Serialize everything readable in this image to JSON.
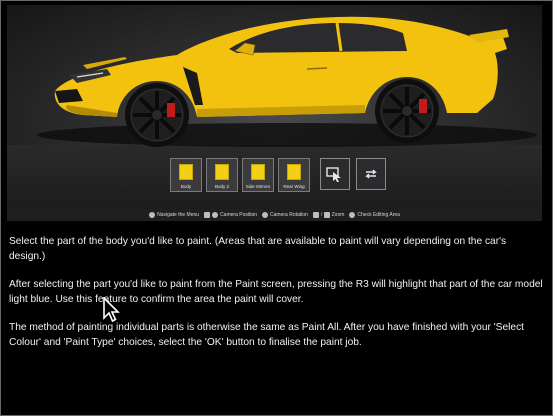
{
  "paint_parts": [
    {
      "label": "Body"
    },
    {
      "label": "Body 2"
    },
    {
      "label": "Side Mirrors"
    },
    {
      "label": "Rear Wing"
    }
  ],
  "colors": {
    "car_body": "#f2c20f",
    "swatch": "#f3cf16",
    "background": "#000000",
    "text": "#f2f2f2"
  },
  "controls": {
    "navigate": "Navigate the Menu",
    "camera_position": "Camera Position",
    "camera_rotation": "Camera Rotation",
    "zoom_sep": "/",
    "zoom": "Zoom",
    "check_area": "Check Editing Area"
  },
  "instructions": {
    "p1": "Select the part of the body you'd like to paint. (Areas that are available to paint will vary depending on the car's design.)",
    "p2": "After selecting the part you'd like to paint from the Paint screen, pressing the R3 will highlight that part of the car model light blue. Use this feature to confirm the area the paint will cover.",
    "p3": "The method of painting individual parts is otherwise the same as Paint All. After you have finished with your 'Select Colour' and 'Paint Type' choices, select the 'OK' button to finalise the paint job."
  },
  "icons": {
    "area_check": "paint-area-select-icon",
    "swap": "swap-arrows-icon",
    "cursor": "mouse-pointer-icon"
  }
}
